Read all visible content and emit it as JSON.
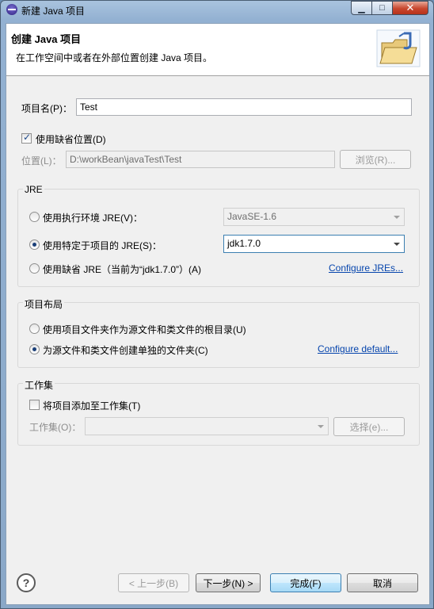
{
  "window": {
    "title": "新建 Java 项目"
  },
  "banner": {
    "title": "创建 Java 项目",
    "description": "在工作空间中或者在外部位置创建 Java 项目。"
  },
  "project_name": {
    "label": "项目名(P)：",
    "value": "Test"
  },
  "use_default_location": {
    "label": "使用缺省位置(D)",
    "checked": true
  },
  "location": {
    "label": "位置(L)：",
    "value": "D:\\workBean\\javaTest\\Test",
    "browse_label": "浏览(R)..."
  },
  "jre": {
    "group_title": "JRE",
    "option_execution_env": {
      "label": "使用执行环境 JRE(V)：",
      "value": "JavaSE-1.6"
    },
    "option_project_specific": {
      "label": "使用特定于项目的 JRE(S)：",
      "value": "jdk1.7.0",
      "selected": true
    },
    "option_default": {
      "label": "使用缺省 JRE（当前为“jdk1.7.0”）(A)"
    },
    "configure_link": "Configure JREs..."
  },
  "layout": {
    "group_title": "项目布局",
    "option_project_folder": {
      "label": "使用项目文件夹作为源文件和类文件的根目录(U)"
    },
    "option_separate_folders": {
      "label": "为源文件和类文件创建单独的文件夹(C)",
      "selected": true
    },
    "configure_link": "Configure default..."
  },
  "working_sets": {
    "group_title": "工作集",
    "add_checkbox": {
      "label": "将项目添加至工作集(T)",
      "checked": false
    },
    "label": "工作集(O)：",
    "value": "",
    "select_label": "选择(e)..."
  },
  "footer": {
    "back_label": "< 上一步(B)",
    "next_label": "下一步(N) >",
    "finish_label": "完成(F)",
    "cancel_label": "取消"
  },
  "colors": {
    "link": "#0645ad",
    "titlebar": "#9bb7d7",
    "close": "#c8472e"
  }
}
